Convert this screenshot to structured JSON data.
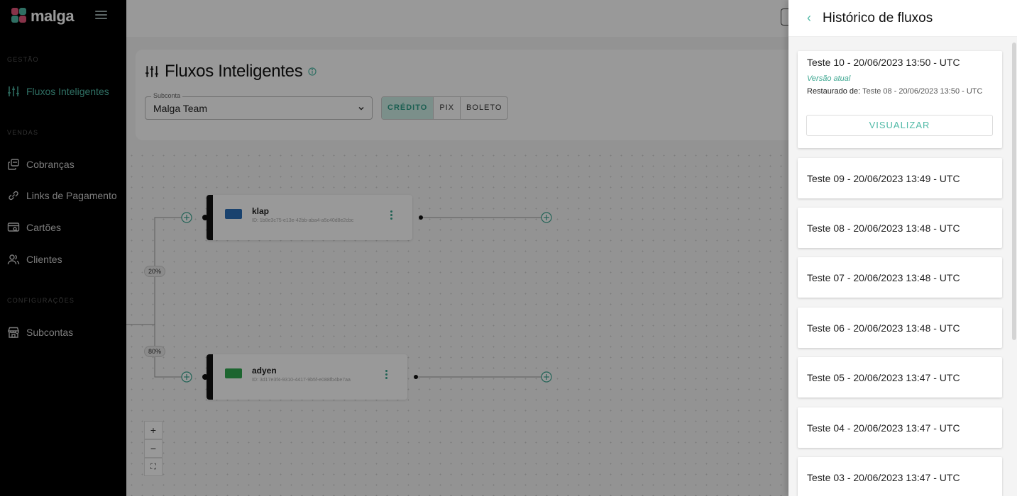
{
  "brand": {
    "name": "malga",
    "accent": "#4fb9a6"
  },
  "sidebar": {
    "sections": [
      {
        "label": "GESTÃO"
      },
      {
        "label": "VENDAS"
      },
      {
        "label": "CONFIGURAÇÕES"
      }
    ],
    "items": [
      {
        "label": "Fluxos Inteligentes",
        "icon": "sliders-icon",
        "active": true
      },
      {
        "label": "Cobranças",
        "icon": "copy-icon"
      },
      {
        "label": "Links de Pagamento",
        "icon": "link-icon"
      },
      {
        "label": "Cartões",
        "icon": "card-search-icon"
      },
      {
        "label": "Clientes",
        "icon": "users-icon"
      },
      {
        "label": "Subcontas",
        "icon": "store-icon"
      }
    ]
  },
  "main": {
    "title": "Fluxos Inteligentes",
    "subaccount": {
      "label": "Subconta",
      "value": "Malga Team"
    },
    "tabs": [
      {
        "label": "CRÉDITO",
        "active": true
      },
      {
        "label": "PIX"
      },
      {
        "label": "BOLETO"
      }
    ],
    "flow": {
      "nodes": [
        {
          "name": "klap",
          "id": "ID: 1b8e3c75-e13e-42bb-aba4-a5c40d8e2cbc"
        },
        {
          "name": "adyen",
          "id": "ID: 3d17e3f4-9310-4417-9b5f-e088fb4be7aa"
        }
      ],
      "splits": [
        "20%",
        "80%"
      ]
    },
    "zoom": [
      "+",
      "−",
      "⛶"
    ]
  },
  "panel": {
    "title": "Histórico de fluxos",
    "current": {
      "title": "Teste 10 - 20/06/2023 13:50 - UTC",
      "badge": "Versão atual",
      "restored_label": "Restaurado de:",
      "restored_value": "Teste 08 - 20/06/2023 13:50 - UTC",
      "button": "VISUALIZAR"
    },
    "items": [
      "Teste 09 - 20/06/2023 13:49 - UTC",
      "Teste 08 - 20/06/2023 13:48 - UTC",
      "Teste 07 - 20/06/2023 13:48 - UTC",
      "Teste 06 - 20/06/2023 13:48 - UTC",
      "Teste 05 - 20/06/2023 13:47 - UTC",
      "Teste 04 - 20/06/2023 13:47 - UTC",
      "Teste 03 - 20/06/2023 13:47 - UTC"
    ]
  }
}
